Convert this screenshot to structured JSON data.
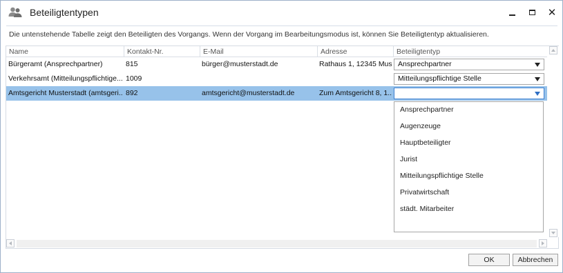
{
  "window": {
    "title": "Beteiligtentypen",
    "icon": "users-icon",
    "description": "Die untenstehende Tabelle zeigt den Beteiligten des Vorgangs. Wenn der Vorgang im Bearbeitungsmodus ist, können Sie Beteiligtentyp aktualisieren."
  },
  "table": {
    "columns": [
      "Name",
      "Kontakt-Nr.",
      "E-Mail",
      "Adresse",
      "Beteiligtentyp"
    ],
    "rows": [
      {
        "name": "Bürgeramt (Ansprechpartner)",
        "kontakt": "815",
        "email": "bürger@musterstadt.de",
        "adresse": "Rathaus 1, 12345 Mus...",
        "typ": "Ansprechpartner"
      },
      {
        "name": "Verkehrsamt (Mitteilungspflichtige...",
        "kontakt": "1009",
        "email": "",
        "adresse": "",
        "typ": "Mitteilungspflichtige Stelle"
      },
      {
        "name": "Amtsgericht Musterstadt (amtsgeri...",
        "kontakt": "892",
        "email": "amtsgericht@musterstadt.de",
        "adresse": "Zum Amtsgericht 8, 1...",
        "typ": ""
      }
    ],
    "selected_row": 2
  },
  "dropdown": {
    "options": [
      "Ansprechpartner",
      "Augenzeuge",
      "Hauptbeteiligter",
      "Jurist",
      "Mitteilungspflichtige Stelle",
      "Privatwirtschaft",
      "städt. Mitarbeiter"
    ]
  },
  "buttons": {
    "ok": "OK",
    "cancel": "Abbrechen"
  },
  "colors": {
    "selection": "#97c2ea",
    "accent": "#2f6fc4"
  }
}
